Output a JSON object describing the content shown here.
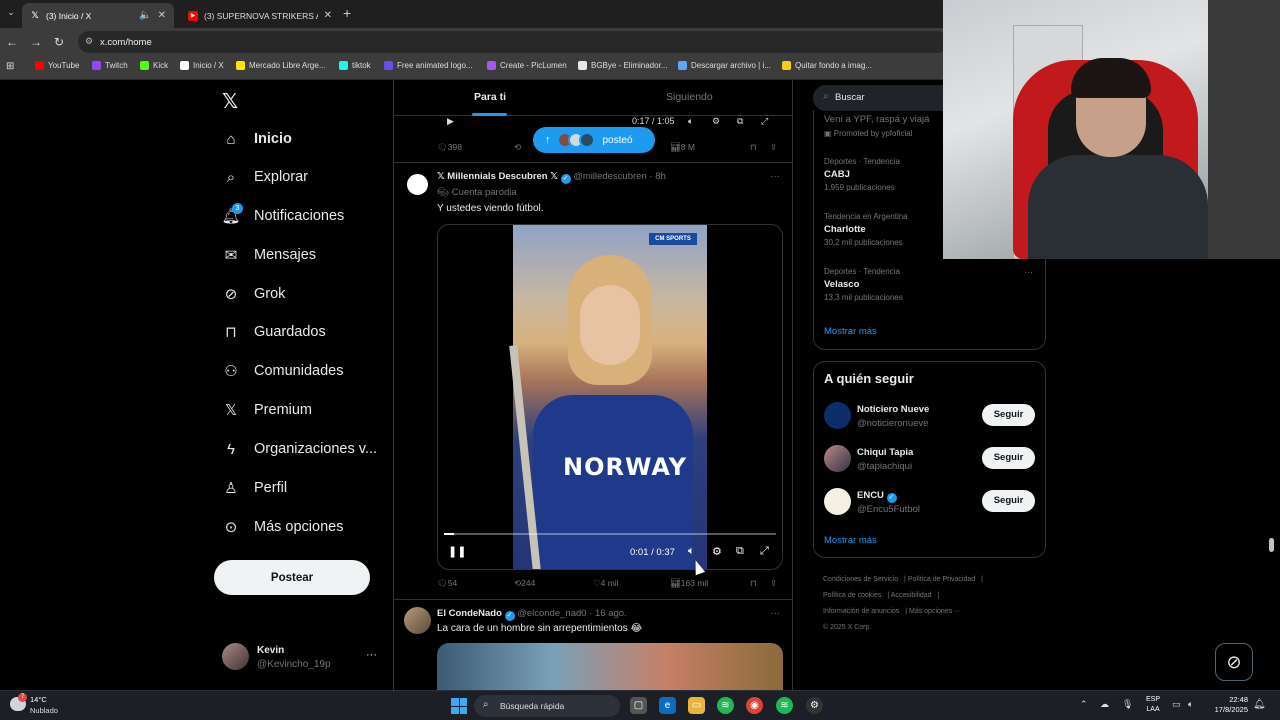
{
  "browser": {
    "tabs": [
      {
        "title": "(3) Inicio / X",
        "active": true
      },
      {
        "title": "(3) SUPERNOVA STRIKERS AMI",
        "active": false
      }
    ],
    "url": "x.com/home",
    "bookmarks": [
      {
        "label": "YouTube",
        "color": "#ff0000"
      },
      {
        "label": "Twitch",
        "color": "#9146ff"
      },
      {
        "label": "Kick",
        "color": "#53fc18"
      },
      {
        "label": "Inicio / X",
        "color": "#ffffff"
      },
      {
        "label": "Mercado Libre Arge...",
        "color": "#ffe600"
      },
      {
        "label": "tiktok",
        "color": "#25f4ee"
      },
      {
        "label": "Free animated logo...",
        "color": "#6b4ce6"
      },
      {
        "label": "Create - PicLumen",
        "color": "#a855f7"
      },
      {
        "label": "BGBye - Eliminador...",
        "color": "#e5e7eb"
      },
      {
        "label": "Descargar archivo | i...",
        "color": "#60a5fa"
      },
      {
        "label": "Quitar fondo a imag...",
        "color": "#facc15"
      }
    ]
  },
  "nav": {
    "items": [
      {
        "label": "Inicio",
        "icon": "home-icon"
      },
      {
        "label": "Explorar",
        "icon": "search-icon"
      },
      {
        "label": "Notificaciones",
        "icon": "bell-icon",
        "badge": "3"
      },
      {
        "label": "Mensajes",
        "icon": "mail-icon"
      },
      {
        "label": "Grok",
        "icon": "grok-icon"
      },
      {
        "label": "Guardados",
        "icon": "bookmark-icon"
      },
      {
        "label": "Comunidades",
        "icon": "communities-icon"
      },
      {
        "label": "Premium",
        "icon": "x-icon"
      },
      {
        "label": "Organizaciones v...",
        "icon": "lightning-icon"
      },
      {
        "label": "Perfil",
        "icon": "person-icon"
      },
      {
        "label": "Más opciones",
        "icon": "more-circle-icon"
      }
    ],
    "post_label": "Postear",
    "account": {
      "name": "Kevin",
      "handle": "@Kevincho_19p"
    }
  },
  "feed": {
    "tabs": {
      "for_you": "Para ti",
      "following": "Siguiendo"
    },
    "prev_video_time": "0:17 / 1:05",
    "posted_pill": "posteó",
    "prev_actions": {
      "replies": "398",
      "views": "8 M"
    },
    "tweet1": {
      "name": "𝕏 Millennials Descubren 𝕏",
      "handle": "@milledescubren",
      "time": "8h",
      "label": "Cuenta parodia",
      "text": "Y ustedes viendo fútbol.",
      "video_time": "0:01 / 0:37",
      "video_progress": 0.03,
      "jersey": "NORWAY",
      "video_logo": "CM SPORTS",
      "replies": "54",
      "reposts": "244",
      "likes": "4 mil",
      "views": "163 mil"
    },
    "tweet2": {
      "name": "El CondeNado",
      "handle": "@elconde_nad0",
      "time": "16 ago.",
      "text": "La cara de un hombre sin arrepentimientos 😂"
    }
  },
  "sidebar": {
    "search_placeholder": "Buscar",
    "promo_text": "Vení a YPF, raspá y viajá",
    "promo_by": "Promoted by ypfoficial",
    "trends": [
      {
        "meta": "Deportes · Tendencia",
        "name": "CABJ",
        "count": "1.959 publicaciones"
      },
      {
        "meta": "Tendencia en Argentina",
        "name": "Charlotte",
        "count": "30,2 mil publicaciones"
      },
      {
        "meta": "Deportes · Tendencia",
        "name": "Velasco",
        "count": "13,3 mil publicaciones"
      }
    ],
    "show_more": "Mostrar más",
    "who_to_follow": {
      "title": "A quién seguir",
      "users": [
        {
          "name": "Noticiero Nueve",
          "handle": "@noticieronueve",
          "button": "Seguir"
        },
        {
          "name": "Chiqui Tapia",
          "handle": "@tapiachiqui",
          "button": "Seguir"
        },
        {
          "name": "ENCU",
          "handle": "@Encu5Futbol",
          "button": "Seguir"
        }
      ],
      "show_more": "Mostrar más"
    },
    "footer": {
      "terms": "Condiciones de Servicio",
      "privacy": "Política de Privacidad",
      "cookies": "Política de cookies",
      "accessibility": "Accesibilidad",
      "ads": "Información de anuncios",
      "more": "Más opciones ···",
      "copyright": "© 2025 X Corp."
    }
  },
  "taskbar": {
    "weather_temp": "14°C",
    "weather_desc": "Nublado",
    "weather_badge": "7",
    "search_label": "Búsqueda rápida",
    "lang_top": "ESP",
    "lang_bottom": "LAA",
    "time": "22:48",
    "date": "17/8/2025"
  },
  "colors": {
    "accent": "#1d9bf0",
    "background": "#000000",
    "muted": "#71767b"
  }
}
